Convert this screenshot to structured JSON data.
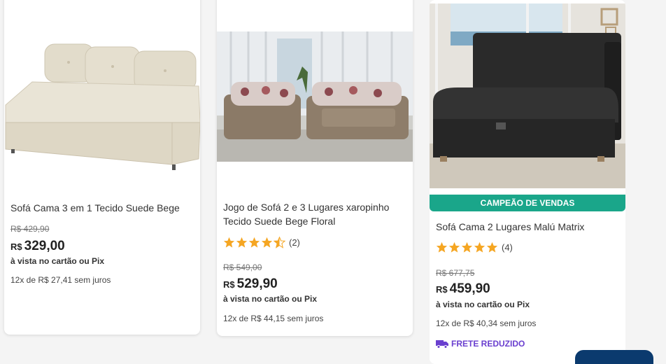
{
  "products": [
    {
      "title": "Sofá Cama 3 em 1 Tecido Suede Bege",
      "old_price": "R$ 429,90",
      "currency": "R$",
      "price": "329,00",
      "cash_note": "à vista no cartão ou Pix",
      "installments": "12x de R$ 27,41 sem juros"
    },
    {
      "title": "Jogo de Sofá 2 e 3 Lugares xaropinho Tecido Suede Bege Floral",
      "rating": 4.5,
      "rating_count": "(2)",
      "old_price": "R$ 549,00",
      "currency": "R$",
      "price": "529,90",
      "cash_note": "à vista no cartão ou Pix",
      "installments": "12x de R$ 44,15 sem juros"
    },
    {
      "badge": "CAMPEÃO DE VENDAS",
      "title": "Sofá Cama 2 Lugares Malú Matrix",
      "rating": 5,
      "rating_count": "(4)",
      "old_price": "R$ 677,75",
      "currency": "R$",
      "price": "459,90",
      "cash_note": "à vista no cartão ou Pix",
      "installments": "12x de R$ 40,34 sem juros",
      "shipping": "FRETE REDUZIDO"
    }
  ],
  "colors": {
    "badge": "#1aa68a",
    "star": "#f5a623",
    "shipping": "#6a3fcf"
  },
  "icons": [
    "star-icon",
    "truck-icon"
  ]
}
